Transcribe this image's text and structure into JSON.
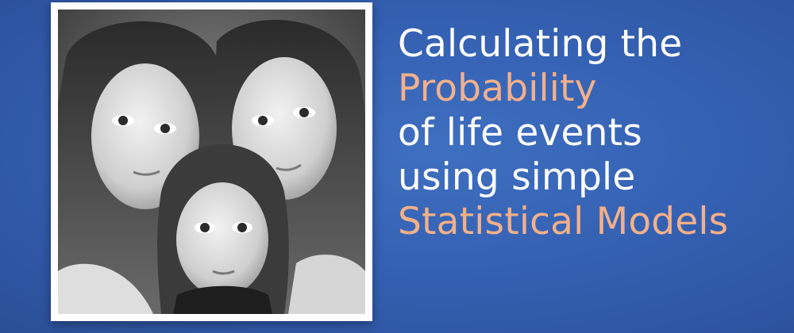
{
  "image": {
    "description_icon": "photo-icon"
  },
  "headline": {
    "lines": [
      {
        "text": "Calculating the",
        "accent": false
      },
      {
        "text": "Probability",
        "accent": true
      },
      {
        "text": "of life events",
        "accent": false
      },
      {
        "text": "using simple",
        "accent": false
      },
      {
        "text": "Statistical Models",
        "accent": true
      }
    ]
  },
  "colors": {
    "background": "#3561b3",
    "headline_text": "#ffffff",
    "headline_accent": "#f2b08a",
    "frame": "#ffffff"
  }
}
